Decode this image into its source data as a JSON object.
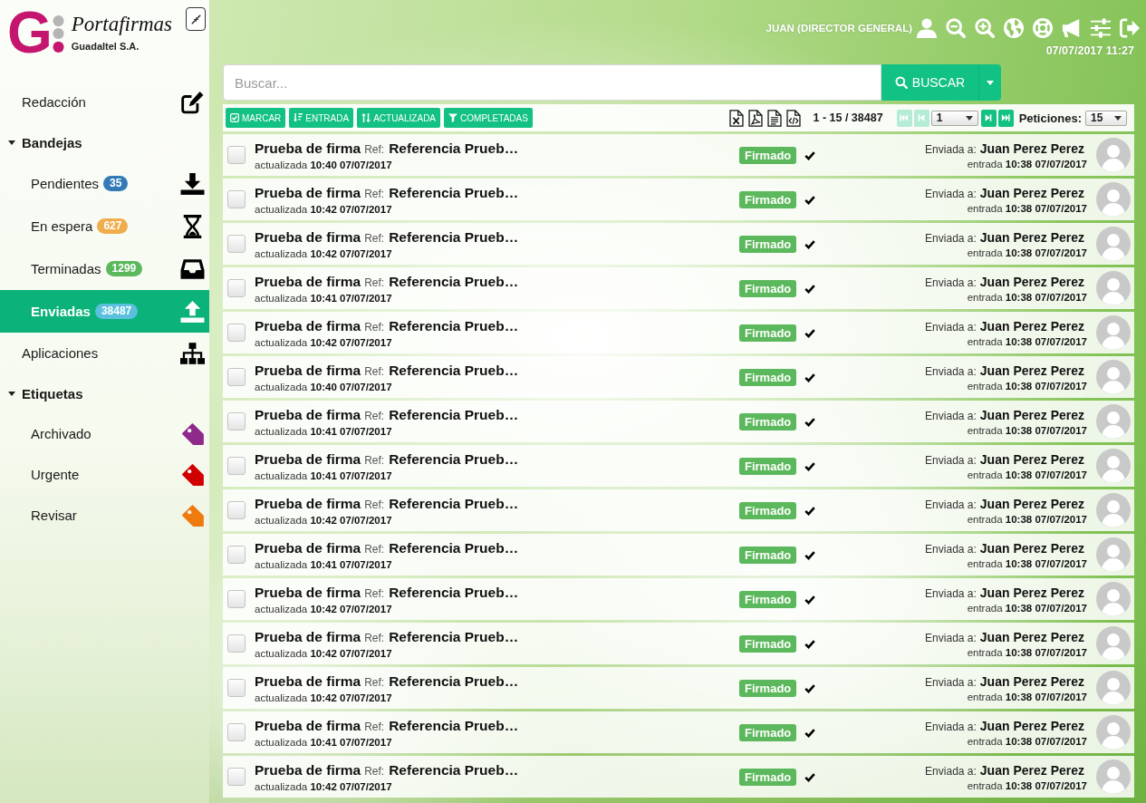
{
  "sidebar": {
    "logo": {
      "letter": "G",
      "name": "Portafirmas",
      "company": "Guadaltel S.A."
    },
    "menu": [
      {
        "kind": "link",
        "label": "Redacción",
        "selected": false
      },
      {
        "kind": "group",
        "label": "Bandejas",
        "expanded": true,
        "children": [
          {
            "kind": "tray",
            "label": "Pendientes",
            "count": "35",
            "color": "#337ab7",
            "selected": false
          },
          {
            "kind": "tray",
            "label": "En espera",
            "count": "627",
            "color": "#f0ad4e",
            "selected": false
          },
          {
            "kind": "tray",
            "label": "Terminadas",
            "count": "1299",
            "color": "#5cb85c",
            "selected": false
          },
          {
            "kind": "tray",
            "label": "Enviadas",
            "count": "38487",
            "color": "#5bc0de",
            "selected": true
          }
        ]
      },
      {
        "kind": "link",
        "label": "Aplicaciones",
        "selected": false
      },
      {
        "kind": "group",
        "label": "Etiquetas",
        "expanded": true,
        "children": [
          {
            "kind": "tag",
            "label": "Archivado",
            "color": "#8e2a8c",
            "selected": false
          },
          {
            "kind": "tag",
            "label": "Urgente",
            "color": "#d10000",
            "selected": false
          },
          {
            "kind": "tag",
            "label": "Revisar",
            "color": "#ef7a0e",
            "selected": false
          }
        ]
      }
    ]
  },
  "header": {
    "user": "JUAN (DIRECTOR GENERAL)",
    "datetime": "07/07/2017 11:27"
  },
  "search": {
    "placeholder": "Buscar...",
    "button": "BUSCAR"
  },
  "toolbar": {
    "actions": [
      "MARCAR",
      "ENTRADA",
      "ACTUALIZADA",
      "COMPLETADAS"
    ],
    "range": "1 - 15 / 38487",
    "pager": {
      "first": {
        "disabled": true
      },
      "previous": {
        "disabled": true
      },
      "page": "1",
      "next": {
        "disabled": false
      },
      "last": {
        "disabled": false
      }
    },
    "per_page_label": "Peticiones:",
    "per_page": "15"
  },
  "rows": [
    {
      "checked": false,
      "title": "Prueba de firma",
      "ref_label": "Ref:",
      "ref": "Referencia Prueb…",
      "updated": "actualizada **10:40 07/07/2017**",
      "status": "Firmado",
      "sent_label": "Enviada a:",
      "recipient": "Juan Perez Perez",
      "entry": "entrada **10:38 07/07/2017**"
    },
    {
      "checked": false,
      "title": "Prueba de firma",
      "ref_label": "Ref:",
      "ref": "Referencia Prueb…",
      "updated": "actualizada **10:42 07/07/2017**",
      "status": "Firmado",
      "sent_label": "Enviada a:",
      "recipient": "Juan Perez Perez",
      "entry": "entrada **10:38 07/07/2017**"
    },
    {
      "checked": false,
      "title": "Prueba de firma",
      "ref_label": "Ref:",
      "ref": "Referencia Prueb…",
      "updated": "actualizada **10:42 07/07/2017**",
      "status": "Firmado",
      "sent_label": "Enviada a:",
      "recipient": "Juan Perez Perez",
      "entry": "entrada **10:38 07/07/2017**"
    },
    {
      "checked": false,
      "title": "Prueba de firma",
      "ref_label": "Ref:",
      "ref": "Referencia Prueb…",
      "updated": "actualizada **10:41 07/07/2017**",
      "status": "Firmado",
      "sent_label": "Enviada a:",
      "recipient": "Juan Perez Perez",
      "entry": "entrada **10:38 07/07/2017**"
    },
    {
      "checked": false,
      "title": "Prueba de firma",
      "ref_label": "Ref:",
      "ref": "Referencia Prueb…",
      "updated": "actualizada **10:42 07/07/2017**",
      "status": "Firmado",
      "sent_label": "Enviada a:",
      "recipient": "Juan Perez Perez",
      "entry": "entrada **10:38 07/07/2017**"
    },
    {
      "checked": false,
      "title": "Prueba de firma",
      "ref_label": "Ref:",
      "ref": "Referencia Prueb…",
      "updated": "actualizada **10:40 07/07/2017**",
      "status": "Firmado",
      "sent_label": "Enviada a:",
      "recipient": "Juan Perez Perez",
      "entry": "entrada **10:38 07/07/2017**"
    },
    {
      "checked": false,
      "title": "Prueba de firma",
      "ref_label": "Ref:",
      "ref": "Referencia Prueb…",
      "updated": "actualizada **10:41 07/07/2017**",
      "status": "Firmado",
      "sent_label": "Enviada a:",
      "recipient": "Juan Perez Perez",
      "entry": "entrada **10:38 07/07/2017**"
    },
    {
      "checked": false,
      "title": "Prueba de firma",
      "ref_label": "Ref:",
      "ref": "Referencia Prueb…",
      "updated": "actualizada **10:41 07/07/2017**",
      "status": "Firmado",
      "sent_label": "Enviada a:",
      "recipient": "Juan Perez Perez",
      "entry": "entrada **10:38 07/07/2017**"
    },
    {
      "checked": false,
      "title": "Prueba de firma",
      "ref_label": "Ref:",
      "ref": "Referencia Prueb…",
      "updated": "actualizada **10:42 07/07/2017**",
      "status": "Firmado",
      "sent_label": "Enviada a:",
      "recipient": "Juan Perez Perez",
      "entry": "entrada **10:38 07/07/2017**"
    },
    {
      "checked": false,
      "title": "Prueba de firma",
      "ref_label": "Ref:",
      "ref": "Referencia Prueb…",
      "updated": "actualizada **10:41 07/07/2017**",
      "status": "Firmado",
      "sent_label": "Enviada a:",
      "recipient": "Juan Perez Perez",
      "entry": "entrada **10:38 07/07/2017**"
    },
    {
      "checked": false,
      "title": "Prueba de firma",
      "ref_label": "Ref:",
      "ref": "Referencia Prueb…",
      "updated": "actualizada **10:42 07/07/2017**",
      "status": "Firmado",
      "sent_label": "Enviada a:",
      "recipient": "Juan Perez Perez",
      "entry": "entrada **10:38 07/07/2017**"
    },
    {
      "checked": false,
      "title": "Prueba de firma",
      "ref_label": "Ref:",
      "ref": "Referencia Prueb…",
      "updated": "actualizada **10:42 07/07/2017**",
      "status": "Firmado",
      "sent_label": "Enviada a:",
      "recipient": "Juan Perez Perez",
      "entry": "entrada **10:38 07/07/2017**"
    },
    {
      "checked": false,
      "title": "Prueba de firma",
      "ref_label": "Ref:",
      "ref": "Referencia Prueb…",
      "updated": "actualizada **10:42 07/07/2017**",
      "status": "Firmado",
      "sent_label": "Enviada a:",
      "recipient": "Juan Perez Perez",
      "entry": "entrada **10:38 07/07/2017**"
    },
    {
      "checked": false,
      "title": "Prueba de firma",
      "ref_label": "Ref:",
      "ref": "Referencia Prueb…",
      "updated": "actualizada **10:41 07/07/2017**",
      "status": "Firmado",
      "sent_label": "Enviada a:",
      "recipient": "Juan Perez Perez",
      "entry": "entrada **10:38 07/07/2017**"
    },
    {
      "checked": false,
      "title": "Prueba de firma",
      "ref_label": "Ref:",
      "ref": "Referencia Prueb…",
      "updated": "actualizada **10:42 07/07/2017**",
      "status": "Firmado",
      "sent_label": "Enviada a:",
      "recipient": "Juan Perez Perez",
      "entry": "entrada **10:38 07/07/2017**"
    }
  ]
}
